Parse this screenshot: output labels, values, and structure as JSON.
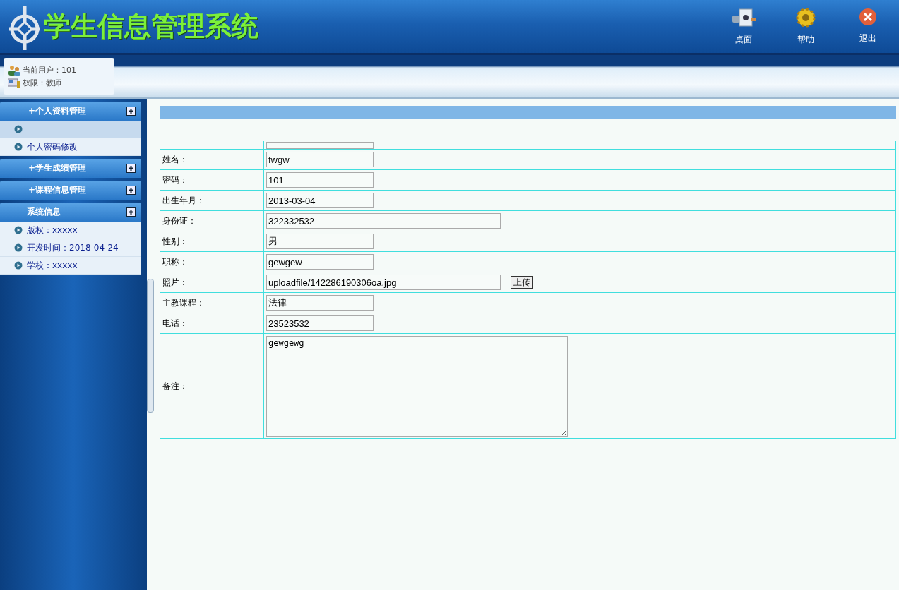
{
  "header": {
    "title": "学生信息管理系统",
    "actions": [
      {
        "kind": "desktop",
        "label": "桌面"
      },
      {
        "kind": "help",
        "label": "帮助"
      },
      {
        "kind": "exit",
        "label": "退出"
      }
    ]
  },
  "user_info": {
    "user": "当前用户：101",
    "role": "权限：教师"
  },
  "sidebar": {
    "groups": [
      {
        "title": "+个人资料管理",
        "items": [
          {
            "hovered": true
          },
          {
            "label": "个人密码修改",
            "hovered": false
          }
        ]
      },
      {
        "title": "+学生成绩管理"
      },
      {
        "title": "+课程信息管理"
      },
      {
        "title": "系统信息",
        "items": [
          {
            "label": "版权：xxxxx",
            "hovered": false
          },
          {
            "label": "开发时间：2018-04-24",
            "hovered": false
          },
          {
            "label": "学校：xxxxx",
            "hovered": false
          }
        ]
      }
    ]
  },
  "form": {
    "rows": [
      {
        "kind": "partial"
      },
      {
        "kind": "text",
        "label": "姓名：",
        "value": "fwgw"
      },
      {
        "kind": "text",
        "label": "密码：",
        "value": "101"
      },
      {
        "kind": "text",
        "label": "出生年月：",
        "value": "2013-03-04"
      },
      {
        "kind": "wide",
        "label": "身份证：",
        "value": "322332532"
      },
      {
        "kind": "text",
        "label": "性别：",
        "value": "男"
      },
      {
        "kind": "text",
        "label": "职称：",
        "value": "gewgew"
      },
      {
        "kind": "upload",
        "label": "照片：",
        "value": "uploadfile/142286190306oa.jpg",
        "button": "上传"
      },
      {
        "kind": "text",
        "label": "主教课程：",
        "value": "法律"
      },
      {
        "kind": "text",
        "label": "电话：",
        "value": "23523532"
      },
      {
        "kind": "textarea",
        "label": "备注：",
        "value": "gewgewg"
      }
    ]
  }
}
